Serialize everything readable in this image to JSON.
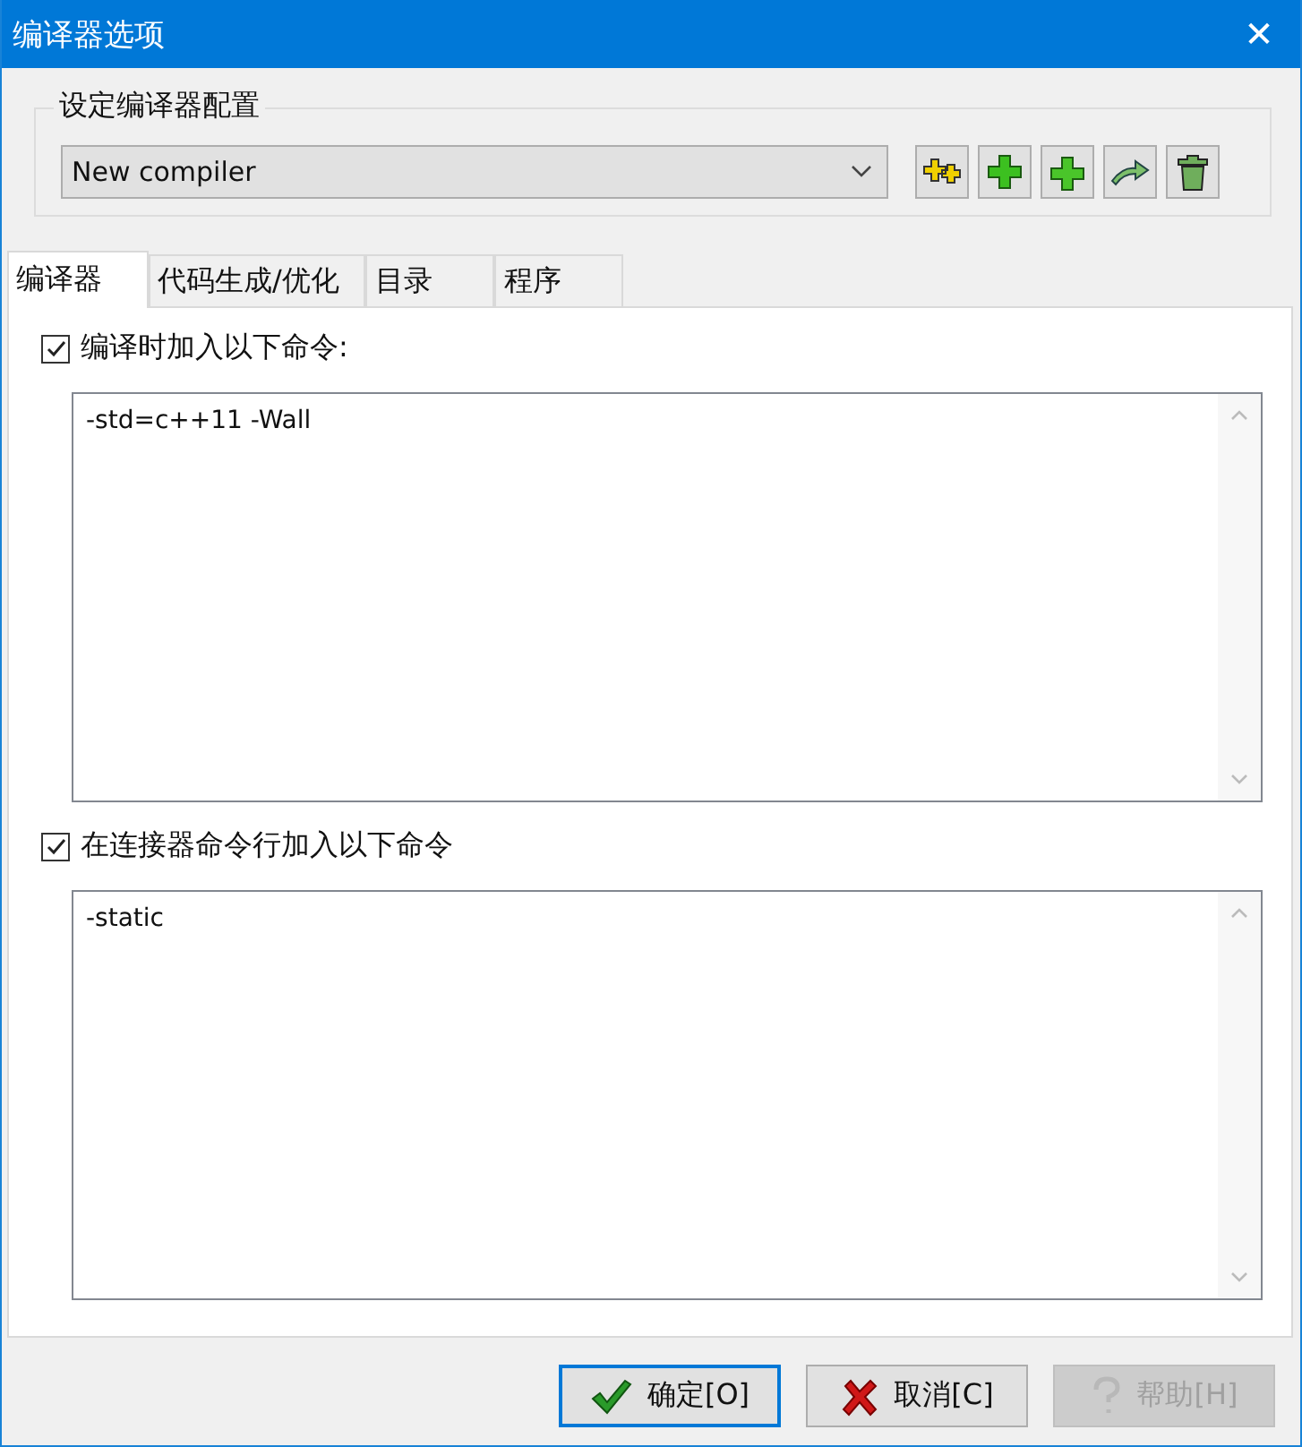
{
  "window": {
    "title": "编译器选项",
    "close": "✕"
  },
  "config_group": {
    "label": "设定编译器配置",
    "compiler": "New compiler"
  },
  "toolbar": [
    {
      "kind": "rename"
    },
    {
      "kind": "add"
    },
    {
      "kind": "add_folder"
    },
    {
      "kind": "export"
    },
    {
      "kind": "delete"
    }
  ],
  "tabs": [
    {
      "label": "编译器",
      "selected": true
    },
    {
      "label": "代码生成/优化",
      "selected": false
    },
    {
      "label": "目录",
      "selected": false
    },
    {
      "label": "程序",
      "selected": false
    }
  ],
  "sections": [
    {
      "label": "编译时加入以下命令:",
      "checked": true,
      "value": "-std=c++11 -Wall"
    },
    {
      "label": "在连接器命令行加入以下命令",
      "checked": true,
      "value": "-static"
    }
  ],
  "buttons": [
    {
      "kind": "ok",
      "label": "确定[O]",
      "disabled": false,
      "focused": true
    },
    {
      "kind": "cancel",
      "label": "取消[C]",
      "disabled": false,
      "focused": false
    },
    {
      "kind": "help",
      "label": "帮助[H]",
      "disabled": true,
      "focused": false
    }
  ]
}
